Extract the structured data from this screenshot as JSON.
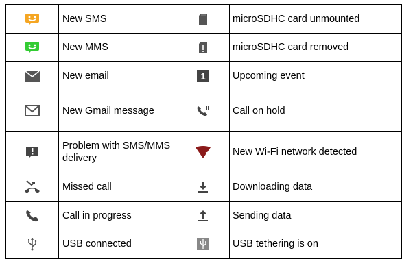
{
  "rows": [
    {
      "left_icon": "sms-icon",
      "left_text": "New SMS",
      "right_icon": "sd-card-unmounted-icon",
      "right_text": "microSDHC card unmounted"
    },
    {
      "left_icon": "mms-icon",
      "left_text": "New MMS",
      "right_icon": "sd-card-removed-icon",
      "right_text": "microSDHC card removed"
    },
    {
      "left_icon": "email-icon",
      "left_text": "New email",
      "right_icon": "upcoming-event-icon",
      "right_text": "Upcoming event"
    },
    {
      "left_icon": "gmail-icon",
      "left_text": "New Gmail message",
      "right_icon": "call-on-hold-icon",
      "right_text": "Call on hold"
    },
    {
      "left_icon": "sms-mms-problem-icon",
      "left_text": "Problem with SMS/MMS delivery",
      "right_icon": "wifi-network-detected-icon",
      "right_text": "New Wi-Fi network detected"
    },
    {
      "left_icon": "missed-call-icon",
      "left_text": "Missed call",
      "right_icon": "download-icon",
      "right_text": "Downloading data"
    },
    {
      "left_icon": "call-in-progress-icon",
      "left_text": "Call in progress",
      "right_icon": "upload-icon",
      "right_text": "Sending data"
    },
    {
      "left_icon": "usb-icon",
      "left_text": "USB connected",
      "right_icon": "usb-tethering-icon",
      "right_text": "USB tethering is on"
    }
  ],
  "icon_badges": {
    "upcoming_event_digit": "1"
  },
  "colors": {
    "sms_orange": "#f5a623",
    "mms_green": "#33cc33",
    "icon_gray": "#555555",
    "wifi_red": "#8b1a1a"
  }
}
